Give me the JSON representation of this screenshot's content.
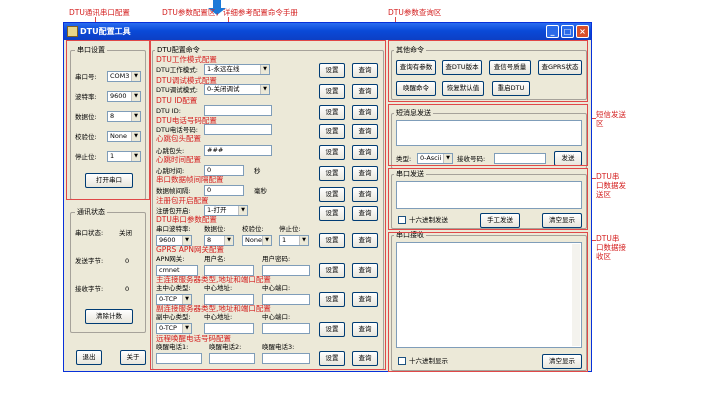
{
  "annotations": {
    "serial_config": "DTU通讯串口配置",
    "param_config": "DTU参数配置区，详细参考配置命令手册",
    "param_query": "DTU参数查询区",
    "sms_send": "短信发送区",
    "serial_send": "DTU串口数据发送区",
    "serial_recv": "DTU串口数据接收区",
    "work_mode": "DTU工作模式配置",
    "debug_mode": "DTU调试模式配置",
    "id_config": "DTU ID配置",
    "phone_config": "DTU电话号码配置",
    "heartbeat_pkt": "心跳包头配置",
    "heartbeat_time": "心跳时间配置",
    "frame_interval": "串口数据帧间隔配置",
    "register_pkt": "注册包开启配置",
    "serial_param": "DTU串口参数配置",
    "gprs_apn": "GPRS APN网关配置",
    "main_server": "主连接服务器类型,地址和端口配置",
    "backup_server": "副连接服务器类型,地址和端口配置",
    "wake_phone": "远程唤醒电话号码配置"
  },
  "window": {
    "title": "DTU配置工具",
    "min": "_",
    "max": "□",
    "close": "×"
  },
  "serial": {
    "title": "串口设置",
    "port_label": "串口号:",
    "port": "COM3",
    "baud_label": "波特率:",
    "baud": "9600",
    "data_label": "数据位:",
    "data": "8",
    "parity_label": "校验位:",
    "parity": "None",
    "stop_label": "停止位:",
    "stop": "1",
    "open_btn": "打开串口"
  },
  "status": {
    "title": "通讯状态",
    "serial_label": "串口状态:",
    "serial_value": "关闭",
    "sent_label": "发送字节:",
    "sent_value": "0",
    "recv_label": "接收字节:",
    "recv_value": "0",
    "clear_btn": "清除计数"
  },
  "bottom": {
    "exit": "退出",
    "about": "关于"
  },
  "config": {
    "title": "DTU配置命令",
    "set": "设置",
    "query": "查询",
    "work_label": "DTU工作模式:",
    "work_value": "1-永远在线",
    "debug_label": "DTU调试模式:",
    "debug_value": "0-关闭调试",
    "id_label": "DTU ID:",
    "id_value": "",
    "phone_label": "DTU电话号码:",
    "phone_value": "",
    "hb_label": "心跳包头:",
    "hb_value": "###",
    "hbt_label": "心跳时间:",
    "hbt_value": "0",
    "hbt_unit": "秒",
    "frame_label": "数据帧间隔:",
    "frame_value": "0",
    "frame_unit": "毫秒",
    "reg_label": "注册包开启:",
    "reg_value": "1-打开",
    "sp_baud_label": "串口波特率:",
    "sp_data_label": "数据位:",
    "sp_parity_label": "校验位:",
    "sp_stop_label": "停止位:",
    "sp_baud": "9600",
    "sp_data": "8",
    "sp_parity": "None",
    "sp_stop": "1",
    "apn_label": "APN网关:",
    "user_label": "用户名:",
    "pwd_label": "用户密码:",
    "apn_value": "cmnet",
    "user_value": "",
    "pwd_value": "",
    "main_type_label": "主中心类型:",
    "main_addr_label": "中心地址:",
    "main_port_label": "中心端口:",
    "main_type": "0-TCP",
    "main_addr": "",
    "main_port": "",
    "bk_type_label": "副中心类型:",
    "bk_addr_label": "中心地址:",
    "bk_port_label": "中心端口:",
    "bk_type": "0-TCP",
    "bk_addr": "",
    "bk_port": "",
    "wake1_label": "唤醒电话1:",
    "wake2_label": "唤醒电话2:",
    "wake3_label": "唤醒电话3:",
    "wake1": "",
    "wake2": "",
    "wake3": ""
  },
  "other": {
    "title": "其他命令",
    "btn_all": "查询有参数",
    "btn_ver": "查DTU版本",
    "btn_sig": "查信号质量",
    "btn_gprs": "查GPRS状态",
    "btn_wake": "唤醒命令",
    "btn_reset": "恢复默认值",
    "btn_restart": "重启DTU"
  },
  "sms": {
    "title": "短消息发送",
    "type_label": "类型:",
    "type_value": "0-Ascii",
    "recv_label": "接收号码:",
    "recv_value": "",
    "send_btn": "发送"
  },
  "serial_send": {
    "title": "串口发送",
    "hex_label": "十六进制发送",
    "manual_btn": "手工发送",
    "clear_btn": "清空显示"
  },
  "serial_recv": {
    "title": "串口接收",
    "hex_label": "十六进制显示",
    "clear_btn": "清空显示"
  }
}
